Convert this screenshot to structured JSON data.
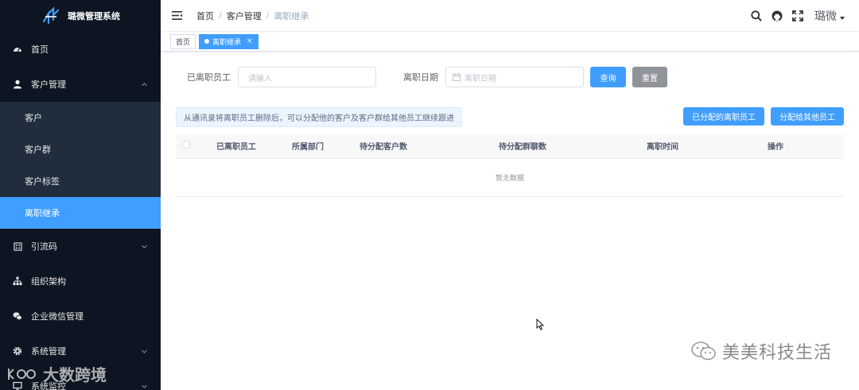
{
  "app": {
    "title": "璐微管理系统"
  },
  "sidebar": {
    "items": [
      {
        "label": "首页",
        "icon": "dashboard-icon"
      },
      {
        "label": "客户管理",
        "icon": "user-icon",
        "expanded": true,
        "children": [
          {
            "label": "客户"
          },
          {
            "label": "客户群"
          },
          {
            "label": "客户标签"
          },
          {
            "label": "离职继承",
            "active": true
          }
        ]
      },
      {
        "label": "引流码",
        "icon": "qrcode-icon"
      },
      {
        "label": "组织架构",
        "icon": "tree-icon"
      },
      {
        "label": "企业微信管理",
        "icon": "wechat-icon"
      },
      {
        "label": "系统管理",
        "icon": "gear-icon"
      },
      {
        "label": "系统监控",
        "icon": "monitor-icon"
      }
    ]
  },
  "header": {
    "breadcrumb": [
      "首页",
      "客户管理",
      "离职继承"
    ],
    "user_name": "璐微"
  },
  "tags": [
    {
      "label": "首页",
      "active": false
    },
    {
      "label": "离职继承",
      "active": true,
      "close": "×"
    }
  ],
  "search": {
    "employee_label": "已离职员工",
    "employee_placeholder": "请输入",
    "date_label": "离职日期",
    "date_placeholder": "离职日期",
    "query_button": "查询",
    "reset_button": "重置"
  },
  "tip": "从通讯录将离职员工删除后，可以分配他的客户及客户群给其他员工继续跟进",
  "actions": {
    "assigned_button": "已分配的离职员工",
    "assign_button": "分配给其他员工"
  },
  "table": {
    "columns": [
      "已离职员工",
      "所属部门",
      "待分配客户数",
      "待分配群聊数",
      "离职时间",
      "操作"
    ],
    "empty_text": "暂无数据"
  },
  "watermarks": {
    "wechat": "美美科技生活",
    "brand": "大数跨境"
  },
  "colors": {
    "sidebar_bg": "#0c1521",
    "submenu_bg": "#1f2d3d",
    "primary": "#409eff",
    "gray_button": "#909399"
  }
}
